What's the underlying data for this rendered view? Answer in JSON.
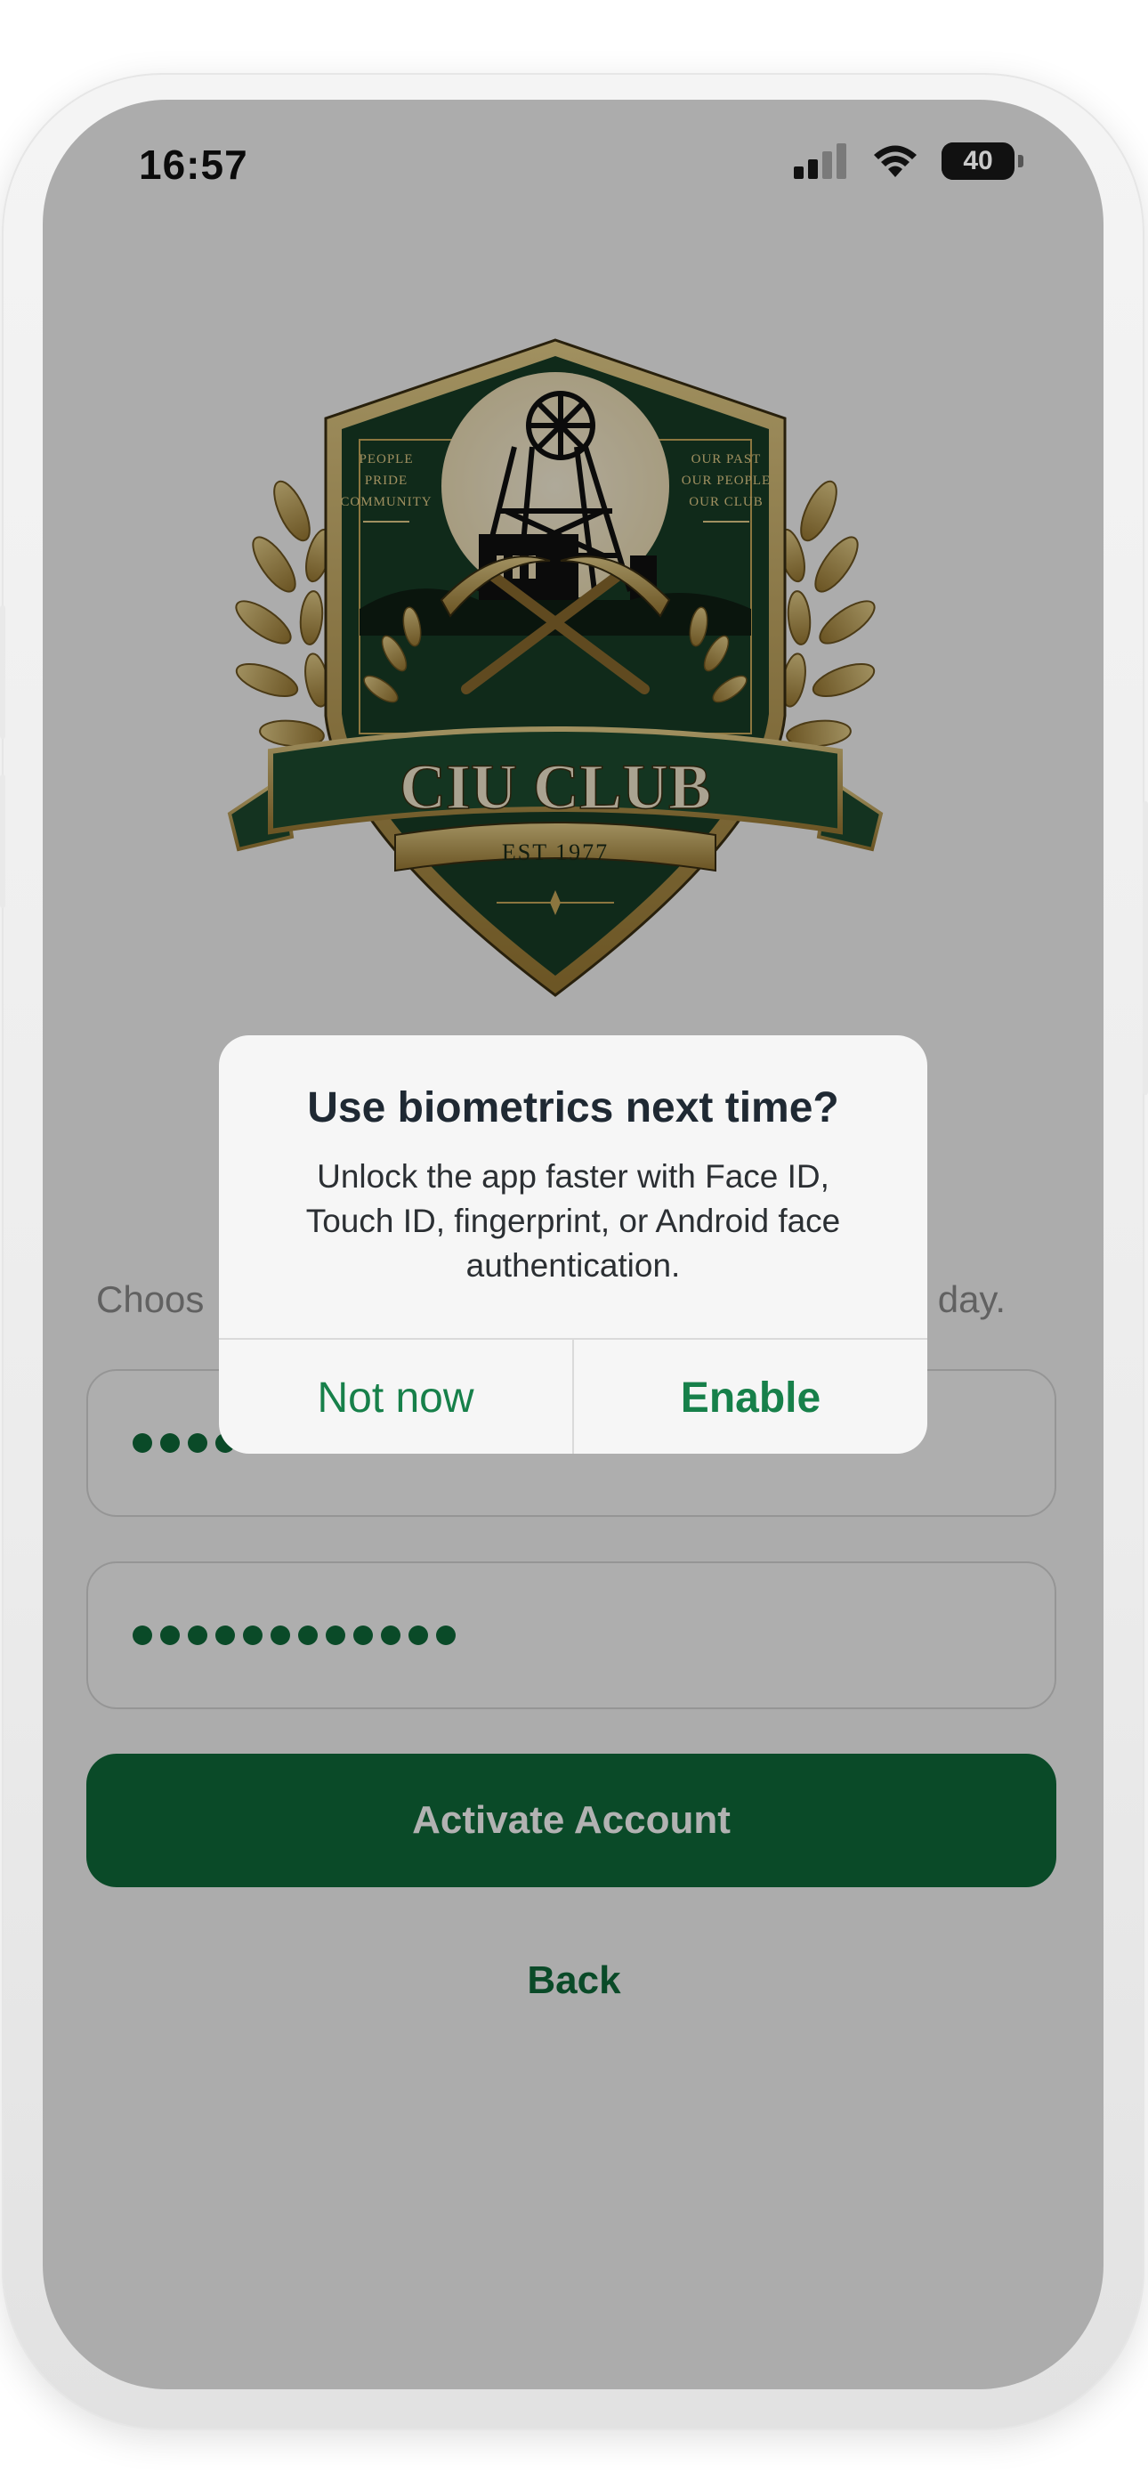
{
  "status_bar": {
    "time": "16:57",
    "battery": "40"
  },
  "logo": {
    "left_motto": [
      "PEOPLE",
      "PRIDE",
      "COMMUNITY"
    ],
    "right_motto": [
      "OUR PAST",
      "OUR PEOPLE",
      "OUR CLUB"
    ],
    "name": "CIU CLUB",
    "established": "EST 1977"
  },
  "subtitle": {
    "visible_left": "Choos",
    "visible_right": "ry day."
  },
  "form": {
    "password_mask_dots": 4,
    "confirm_mask_dots": 12,
    "activate_label": "Activate Account",
    "back_label": "Back"
  },
  "dialog": {
    "title": "Use biometrics next time?",
    "body": "Unlock the app faster with Face ID, Touch ID, fingerprint, or Android face authentication.",
    "secondary_label": "Not now",
    "primary_label": "Enable"
  },
  "colors": {
    "brand_green": "#0f6b3a",
    "dialog_action_green": "#17804a",
    "dialog_background": "#f6f6f6",
    "overlay": "rgba(0,0,0,0.30)"
  }
}
